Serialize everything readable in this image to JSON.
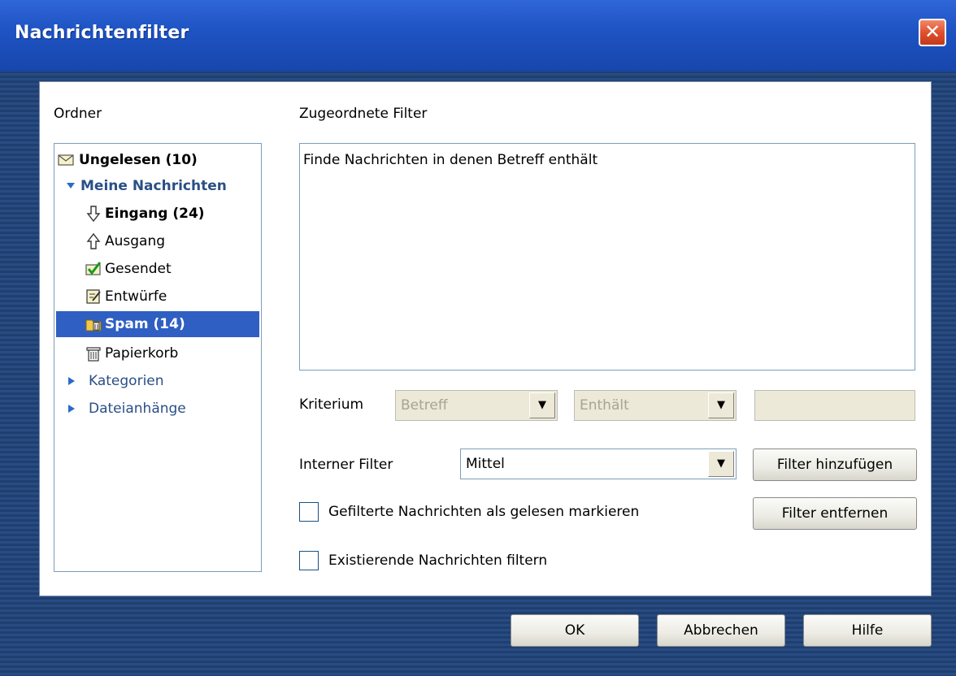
{
  "window": {
    "title": "Nachrichtenfilter",
    "close_glyph": "✕"
  },
  "left": {
    "label": "Ordner",
    "tree": [
      {
        "label": "Ungelesen (10)",
        "icon": "envelope-icon"
      },
      {
        "label": "Meine Nachrichten",
        "icon": "expand-arrow-icon"
      },
      {
        "label": "Eingang (24)",
        "icon": "inbox-down-arrow-icon"
      },
      {
        "label": "Ausgang",
        "icon": "outbox-up-arrow-icon"
      },
      {
        "label": "Gesendet",
        "icon": "sent-check-icon"
      },
      {
        "label": "Entwürfe",
        "icon": "drafts-icon"
      },
      {
        "label": "Spam (14)",
        "icon": "spam-icon"
      },
      {
        "label": "Papierkorb",
        "icon": "trash-icon"
      },
      {
        "label": "Kategorien",
        "icon": "collapse-arrow-icon"
      },
      {
        "label": "Dateianhänge",
        "icon": "collapse-arrow-icon"
      }
    ]
  },
  "right": {
    "label": "Zugeordnete Filter",
    "filter_text": "Finde Nachrichten in denen Betreff enthält",
    "kriterium_label": "Kriterium",
    "field_value": "Betreff",
    "operator_value": "Enthält",
    "criteria_value": "",
    "intern_label": "Interner Filter",
    "intern_value": "Mittel",
    "add_filter": "Filter hinzufügen",
    "remove_filter": "Filter entfernen",
    "mark_read": "Gefilterte Nachrichten als gelesen markieren",
    "filter_existing": "Existierende Nachrichten filtern"
  },
  "footer": {
    "ok": "OK",
    "cancel": "Abbrechen",
    "help": "Hilfe"
  },
  "colors": {
    "selection": "#2f5fc2",
    "title_bar": "#1f54c4",
    "tree_blue": "#2a4f86"
  }
}
